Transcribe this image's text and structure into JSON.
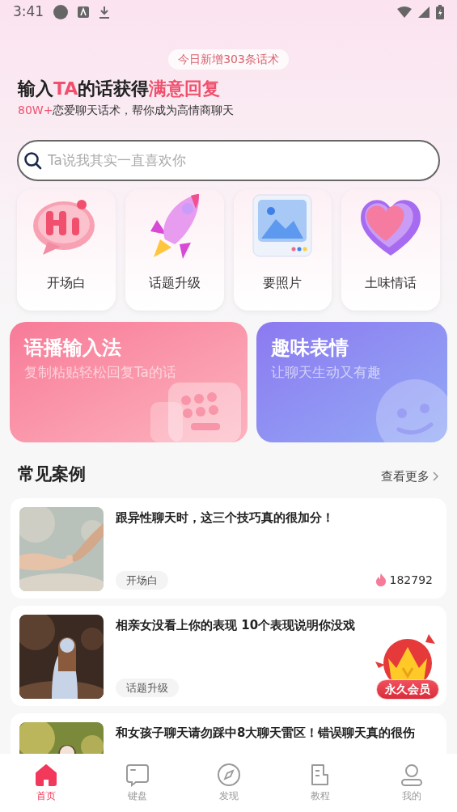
{
  "status_bar": {
    "time": "3:41"
  },
  "banner": {
    "badge": "今日新增303条话术",
    "headline": [
      {
        "text": "输入",
        "highlight": false
      },
      {
        "text": "TA",
        "highlight": true
      },
      {
        "text": "的话获得",
        "highlight": false
      },
      {
        "text": "满意回复",
        "highlight": true
      }
    ],
    "subtitle": [
      {
        "text": "80W+",
        "highlight": true
      },
      {
        "text": "恋爱聊天话术，帮你成为高情商聊天",
        "highlight": false
      }
    ]
  },
  "search": {
    "placeholder": "Ta说我其实一直喜欢你"
  },
  "categories": [
    {
      "kind": "hi",
      "label": "开场白"
    },
    {
      "kind": "rocket",
      "label": "话题升级"
    },
    {
      "label": "要照片"
    },
    {
      "kind": "heart",
      "label": "土味情话"
    }
  ],
  "features": [
    {
      "kind": "keyboard",
      "title": "语播输入法",
      "subtitle": "复制粘贴轻松回复Ta的话"
    },
    {
      "kind": "emoji",
      "title": "趣味表情",
      "subtitle": "让聊天生动又有趣"
    }
  ],
  "cases": {
    "title": "常见案例",
    "more": "查看更多",
    "items": [
      {
        "kind": "picture",
        "title": "跟异性聊天时，这三个技巧真的很加分！",
        "tag": "开场白",
        "count": "182792"
      },
      {
        "kind": "picture",
        "title": "相亲女没看上你的表现 10个表现说明你没戏",
        "tag": "话题升级"
      },
      {
        "kind": "picture",
        "title": "和女孩子聊天请勿踩中8大聊天雷区！错误聊天真的很伤"
      }
    ]
  },
  "vip_badge": {
    "label": "永久会员"
  },
  "tab_bar": [
    {
      "kind": "home",
      "label": "首页",
      "selected": true
    },
    {
      "kind": "keyboard",
      "label": "键盘",
      "selected": false
    },
    {
      "kind": "compass",
      "label": "发现",
      "selected": false
    },
    {
      "kind": "doc",
      "label": "教程",
      "selected": false
    },
    {
      "kind": "user",
      "label": "我的",
      "selected": false
    }
  ]
}
